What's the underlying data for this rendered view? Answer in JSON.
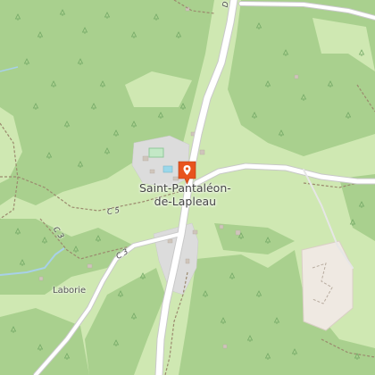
{
  "map": {
    "type": "topographic",
    "colors": {
      "forest": "#a9d08e",
      "meadow": "#cfe8b2",
      "road": "#ffffff",
      "road_casing": "#c8c8c8",
      "settlement": "#dcdcdc",
      "marker": "#e8541e",
      "water": "#a8d0e8",
      "track": "#9b8a6e"
    },
    "places": {
      "town_line1": "Saint-Pantaléon-",
      "town_line2": "de-Lapleau",
      "locality": "Laborie"
    },
    "road_refs": {
      "c5": "C 5",
      "c3": "C 3",
      "top": "D"
    },
    "marker": {
      "icon": "location-pin-icon"
    }
  }
}
